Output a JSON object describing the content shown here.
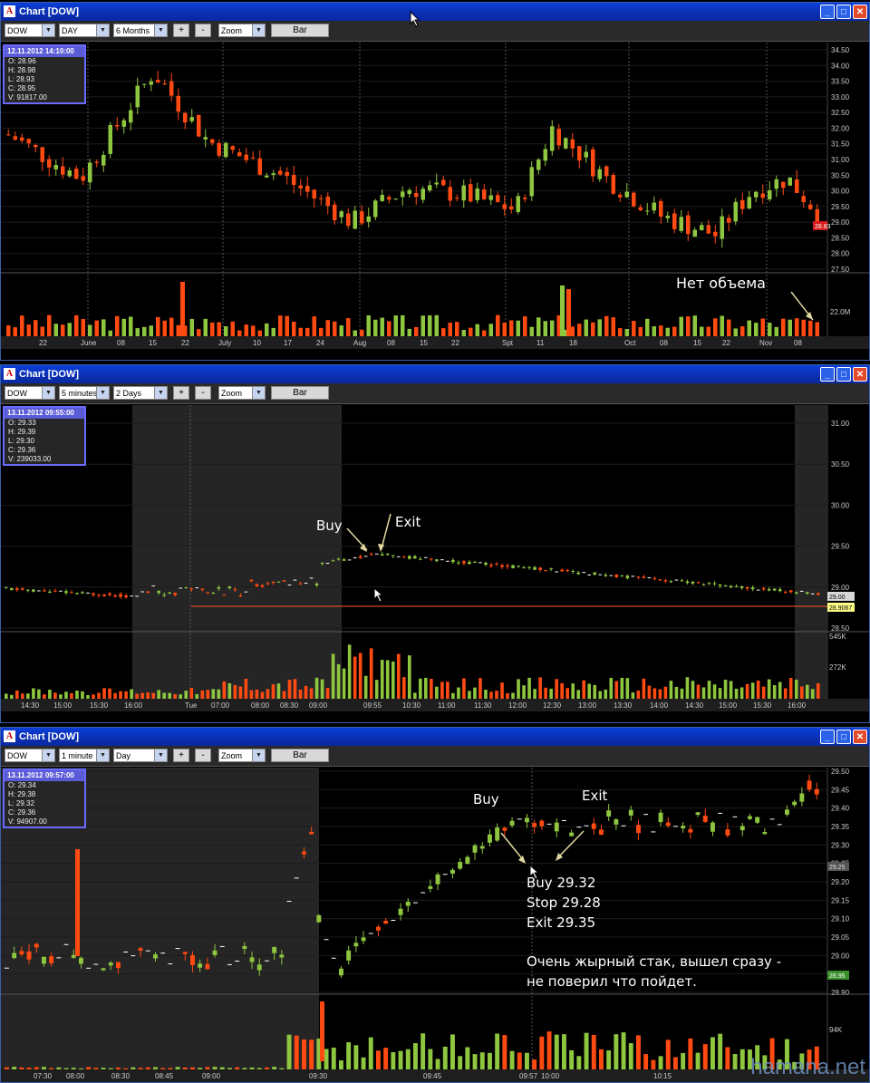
{
  "windows": [
    {
      "title": "Chart [DOW]",
      "toolbar": {
        "symbol": "DOW",
        "interval": "DAY",
        "range": "6 Months",
        "plus": "+",
        "minus": "-",
        "zoom": "Zoom",
        "style": "Bar"
      },
      "info": {
        "timestamp": "12.11.2012 14:10:00",
        "o": "O: 28.96",
        "h": "H: 28.98",
        "l": "L: 28.93",
        "c": "C: 28.95",
        "v": "V: 91817.00"
      },
      "price_labels": [
        "34.50",
        "34.00",
        "33.50",
        "33.00",
        "32.50",
        "32.00",
        "31.50",
        "31.00",
        "30.50",
        "30.00",
        "29.50",
        "29.00",
        "28.50",
        "28.00",
        "27.50"
      ],
      "last_price": "28.83",
      "volume_label": "22.0M",
      "x_labels": [
        "22",
        "June",
        "08",
        "15",
        "22",
        "July",
        "10",
        "17",
        "24",
        "Aug",
        "08",
        "15",
        "22",
        "Spt",
        "11",
        "18",
        "Oct",
        "08",
        "15",
        "22",
        "Nov",
        "08"
      ],
      "annotation": "Нет объема"
    },
    {
      "title": "Chart [DOW]",
      "toolbar": {
        "symbol": "DOW",
        "interval": "5 minutes",
        "range": "2 Days",
        "plus": "+",
        "minus": "-",
        "zoom": "Zoom",
        "style": "Bar"
      },
      "info": {
        "timestamp": "13.11.2012 09:55:00",
        "o": "O: 29.33",
        "h": "H: 29.39",
        "l": "L: 29.30",
        "c": "C: 29.36",
        "v": "V: 239033.00"
      },
      "price_labels": [
        "31.00",
        "30.50",
        "30.00",
        "29.50",
        "29.00",
        "28.50"
      ],
      "last_price": "29.00",
      "line_price": "28.9067",
      "volume_labels": [
        "545K",
        "272K"
      ],
      "x_labels": [
        "14:30",
        "15:00",
        "15:30",
        "16:00",
        "Tue",
        "07:00",
        "08:00",
        "08:30",
        "09:00",
        "09:55",
        "10:30",
        "11:00",
        "11:30",
        "12:00",
        "12:30",
        "13:00",
        "13:30",
        "14:00",
        "14:30",
        "15:00",
        "15:30",
        "16:00"
      ],
      "buy": "Buy",
      "exit": "Exit"
    },
    {
      "title": "Chart [DOW]",
      "toolbar": {
        "symbol": "DOW",
        "interval": "1 minute",
        "range": "Day",
        "plus": "+",
        "minus": "-",
        "zoom": "Zoom",
        "style": "Bar"
      },
      "info": {
        "timestamp": "13.11.2012 09:57:00",
        "o": "O: 29.34",
        "h": "H: 29.38",
        "l": "L: 29.32",
        "c": "C: 29.36",
        "v": "V: 94907.00"
      },
      "price_labels": [
        "29.50",
        "29.45",
        "29.40",
        "29.35",
        "29.30",
        "29.25",
        "29.20",
        "29.15",
        "29.10",
        "29.05",
        "29.00",
        "28.95",
        "28.90"
      ],
      "last_price": "29.25",
      "low_price": "28.95",
      "volume_label": "94K",
      "x_labels": [
        "07:30",
        "08:00",
        "08:30",
        "08:45",
        "09:00",
        "09:30",
        "09:45",
        "09:57",
        "10:00",
        "10:15"
      ],
      "buy": "Buy",
      "exit": "Exit",
      "note_lines": [
        "Buy 29.32",
        "Stop 29.28",
        "Exit 29.35"
      ],
      "comment_lines": [
        "Очень жырный стак, вышел сразу -",
        "не поверил что пойдет."
      ]
    }
  ],
  "watermark": "hamana.net",
  "colors": {
    "up": "#8ec63f",
    "down": "#ff4a12",
    "neutral": "#ffffff",
    "info_border": "#6a6aff"
  }
}
